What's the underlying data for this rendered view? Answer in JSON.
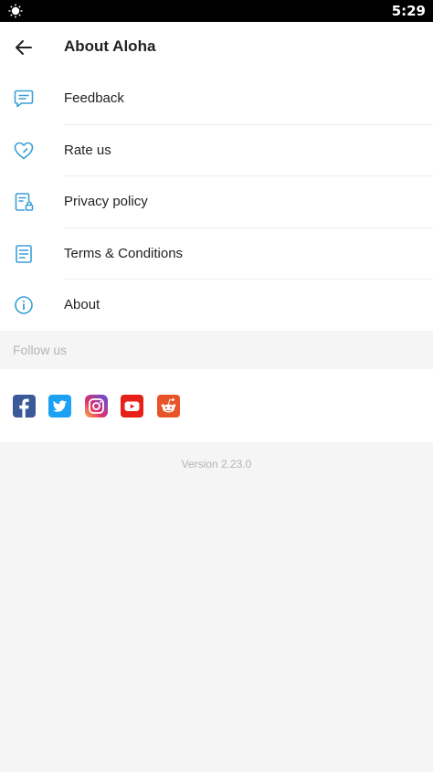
{
  "status_bar": {
    "time": "5:29"
  },
  "header": {
    "title": "About Aloha"
  },
  "accent_color": "#3a9fd6",
  "menu": [
    {
      "label": "Feedback",
      "icon": "feedback-icon"
    },
    {
      "label": "Rate us",
      "icon": "heart-icon"
    },
    {
      "label": "Privacy policy",
      "icon": "privacy-document-icon"
    },
    {
      "label": "Terms & Conditions",
      "icon": "document-icon"
    },
    {
      "label": "About",
      "icon": "info-icon"
    }
  ],
  "follow": {
    "title": "Follow us",
    "networks": [
      {
        "name": "facebook",
        "color": "#3b5998"
      },
      {
        "name": "twitter",
        "color": "#1da1f2"
      },
      {
        "name": "instagram",
        "color": "#c13584"
      },
      {
        "name": "youtube",
        "color": "#e62117"
      },
      {
        "name": "reddit",
        "color": "#e8542a"
      }
    ]
  },
  "version": "Version 2.23.0"
}
